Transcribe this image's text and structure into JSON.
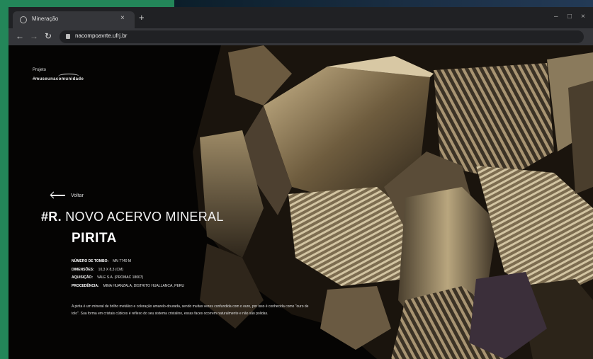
{
  "browser": {
    "tab_title": "Mineração",
    "tab_close": "×",
    "new_tab": "+",
    "back": "←",
    "forward": "→",
    "reload": "↻",
    "url": "nacompoavrte.ufrj.br",
    "window_controls": [
      "–",
      "□",
      "×"
    ]
  },
  "page": {
    "logo_top": "Projeto",
    "logo_bottom": "#museunacomunidade",
    "back_label": "Voltar",
    "headline_code": "#R.",
    "headline_title": "NOVO ACERVO MINERAL",
    "mineral_name": "PIRITA",
    "specs": [
      {
        "key": "NÚMERO DE TOMBO:",
        "value": "MN 7740 M"
      },
      {
        "key": "DIMENSÕES:",
        "value": "10,3 X 8,3 (CM)"
      },
      {
        "key": "AQUISIÇÃO:",
        "value": "VALE S.A. (PROMAC 18007)"
      },
      {
        "key": "PROCEDÊNCIA:",
        "value": "MINA HUANZALA, DISTRITO HUALLANCA, PERU"
      }
    ],
    "description": "A pirita é um mineral de brilho metálico e coloração amarelo-dourada, sendo muitas vezes confundida com o ouro, por isso é conhecida como \"ouro de tolo\". Sua forma em cristais cúbicos é reflexo do seu sistema cristalino, essas faces ocorrem naturalmente e não são polidas."
  },
  "colors": {
    "desktop_green": "#238659",
    "tab_bar": "#202124",
    "toolbar": "#35363a",
    "page_bg": "#050403",
    "pyrite_gold": "#a88f5e"
  }
}
